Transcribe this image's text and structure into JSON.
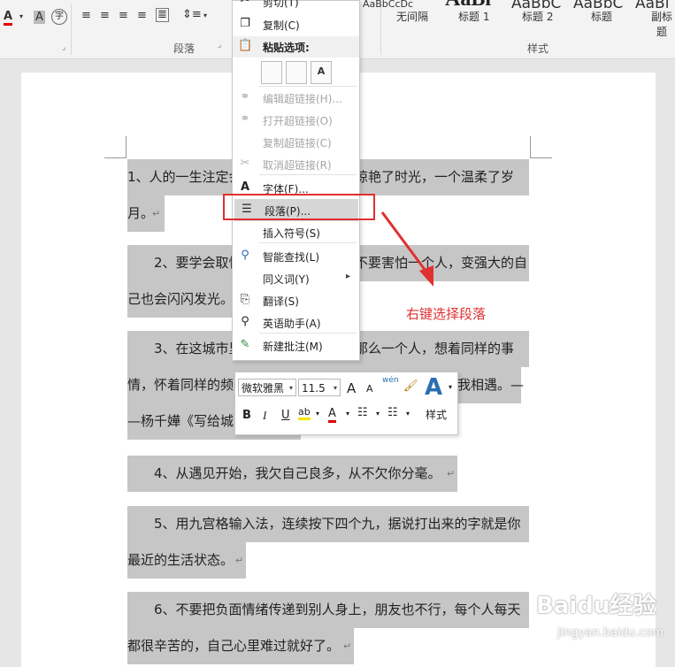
{
  "ribbon": {
    "font_color_label": "A",
    "highlight_label": "A",
    "paragraph_group": "段落",
    "styles_group": "样式",
    "styles": [
      {
        "preview": "AaBbCcDc",
        "name": "无间隔"
      },
      {
        "preview": "AaBl",
        "name": "标题 1"
      },
      {
        "preview": "AaBbC",
        "name": "标题 2"
      },
      {
        "preview": "AaBbC",
        "name": "标题"
      },
      {
        "preview": "AaBl",
        "name": "副标题"
      }
    ],
    "enclose_char": "字"
  },
  "context_menu": {
    "cut": "剪切(T)",
    "copy": "复制(C)",
    "paste_header": "粘贴选项:",
    "paste_opts": [
      "",
      "",
      "A"
    ],
    "edit_link": "编辑超链接(H)...",
    "open_link": "打开超链接(O)",
    "copy_link": "复制超链接(C)",
    "remove_link": "取消超链接(R)",
    "font": "字体(F)...",
    "paragraph": "段落(P)...",
    "insert_symbol": "插入符号(S)",
    "smart_lookup": "智能查找(L)",
    "synonyms": "同义词(Y)",
    "translate": "翻译(S)",
    "english_assistant": "英语助手(A)",
    "new_comment": "新建批注(M)",
    "font_icon": "A",
    "arrow": "▸"
  },
  "mini_toolbar": {
    "font_name": "微软雅黑",
    "font_size": "11.5",
    "grow": "A",
    "shrink": "A",
    "bold": "B",
    "italic": "I",
    "underline": "U",
    "style_label": "样式",
    "phonetic": "wén"
  },
  "document": {
    "paragraphs": [
      {
        "lines": [
          "1、人的一生注定会",
          "惊艳了时光，一个温柔了岁",
          "月。"
        ]
      },
      {
        "lines": [
          "　　2、要学会取悦",
          "不要害怕一个人，变强大的自",
          "己也会闪闪发光。"
        ]
      },
      {
        "lines": [
          "　　3、在这城市里",
          "那么一个人，想着同样的事",
          "情，怀着同样的频",
          "我相遇。—",
          "—杨千嬅《写给城"
        ]
      },
      {
        "lines": [
          "　　4、从遇见开始，我欠自己良多，从不欠你分毫。"
        ]
      },
      {
        "lines": [
          "　　5、用九宫格输入法，连续按下四个九，据说打出来的字就是你",
          "最近的生活状态。"
        ]
      },
      {
        "lines": [
          "　　6、不要把负面情绪传递到别人身上，朋友也不行，每个人每天",
          "都很辛苦的，自己心里难过就好了。"
        ]
      }
    ],
    "para_mark": "↵"
  },
  "annotation": {
    "text": "右键选择段落",
    "color": "#e03030"
  },
  "watermark": {
    "text": "Baidu经验",
    "sub": "jingyan.baidu.com"
  }
}
